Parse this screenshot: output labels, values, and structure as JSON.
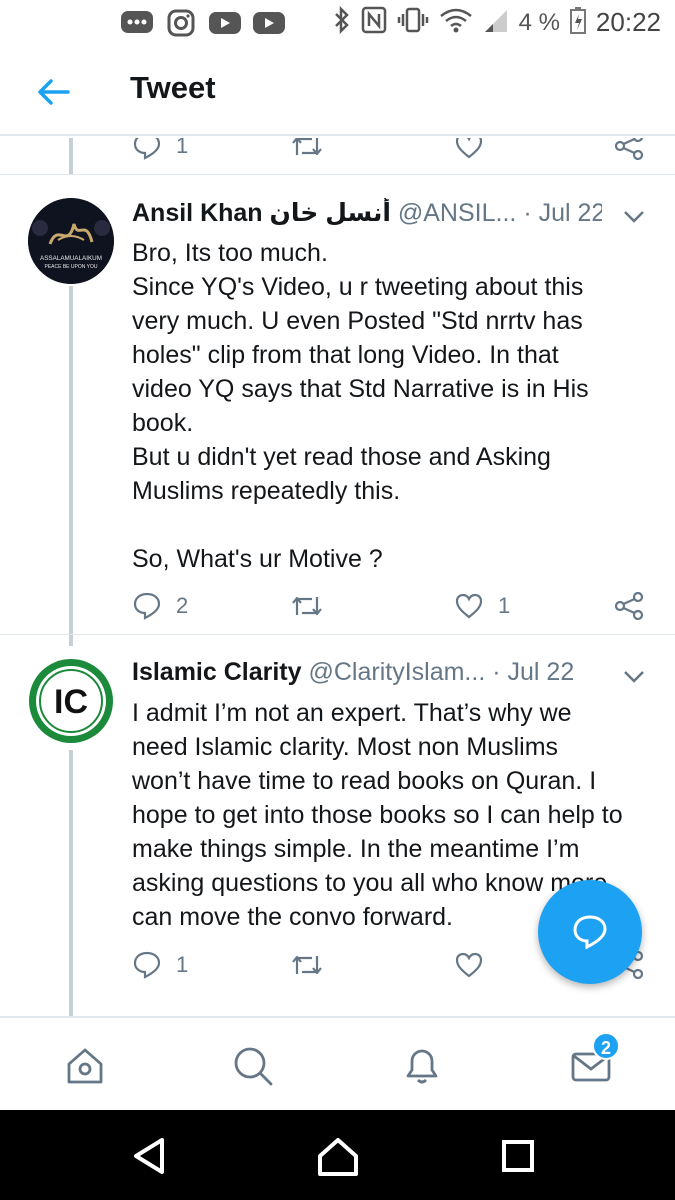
{
  "status_bar": {
    "battery_percent": "4 %",
    "time": "20:22",
    "left_icons": [
      "messages-icon",
      "instagram-icon",
      "youtube-icon",
      "youtube-icon"
    ],
    "right_icons": [
      "bluetooth-icon",
      "nfc-icon",
      "vibrate-icon",
      "wifi-icon",
      "signal-icon",
      "battery-icon"
    ]
  },
  "header": {
    "title": "Tweet",
    "back_icon": "arrow-left-icon"
  },
  "previous_tweet_actions": {
    "reply_count": "1"
  },
  "tweets": [
    {
      "name": "Ansil Khan أنسل خان",
      "handle": "@ANSIL...",
      "separator": "·",
      "date": "Jul 22",
      "avatar_text_top": "ASSALAMUALAIKUM",
      "avatar_text_bottom": "PEACE BE UPON YOU",
      "body_lines": [
        "Bro, Its too much.",
        "Since YQ's Video, u r tweeting about this",
        "very much. U even  Posted \"Std nrrtv has",
        "holes\" clip from that long Video. In that",
        "video YQ says that Std Narrative is in His",
        "book.",
        "But u didn't yet read those and Asking",
        "Muslims repeatedly this.",
        "",
        "So, What's ur Motive ?"
      ],
      "reply_count": "2",
      "like_count": "1"
    },
    {
      "name": "Islamic Clarity",
      "handle": "@ClarityIslam...",
      "separator": "·",
      "date": "Jul 22",
      "avatar_text": "IC",
      "body_lines": [
        "I admit I’m not an expert. That’s why we",
        "need Islamic clarity. Most non Muslims",
        "won’t have time to read books on Quran. I",
        "hope to get into those books so I can help to",
        "make things simple. In the meantime I’m",
        "asking questions to you all who know more",
        "can move the convo forward."
      ],
      "reply_count": "1"
    }
  ],
  "bottom_nav": {
    "items": [
      "home-icon",
      "search-icon",
      "notifications-icon",
      "messages-icon"
    ],
    "messages_badge": "2"
  },
  "colors": {
    "accent": "#1da1f2",
    "text": "#14171a",
    "secondary": "#657786",
    "ic_green": "#1b8a3a"
  }
}
